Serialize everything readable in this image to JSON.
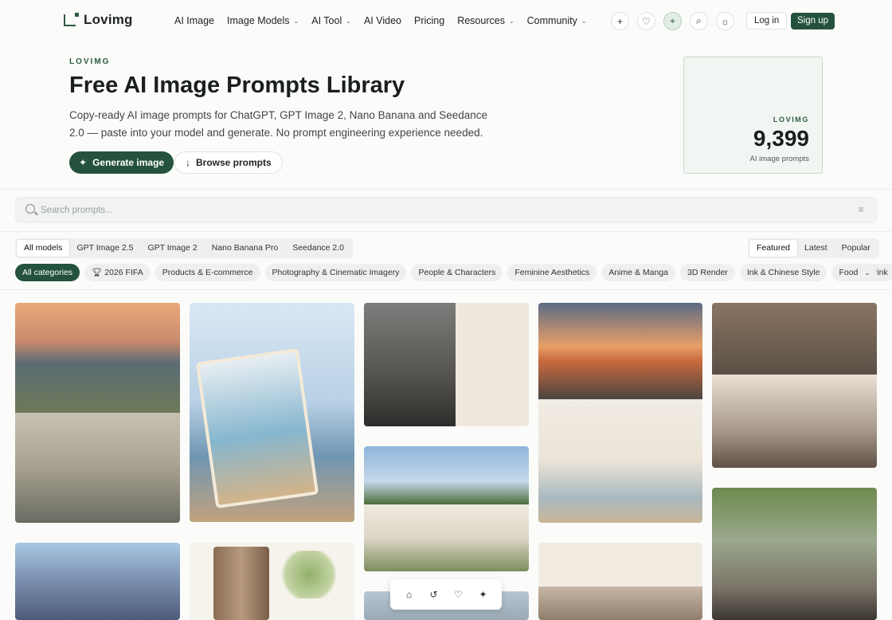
{
  "brand": {
    "name": "Lovimg"
  },
  "nav": [
    {
      "label": "AI Image",
      "chevron": false
    },
    {
      "label": "Image Models",
      "chevron": true
    },
    {
      "label": "AI Tool",
      "chevron": true
    },
    {
      "label": "AI Video",
      "chevron": false
    },
    {
      "label": "Pricing",
      "chevron": false
    },
    {
      "label": "Resources",
      "chevron": true
    },
    {
      "label": "Community",
      "chevron": true
    }
  ],
  "header_icons": [
    "plus-icon",
    "heart-icon",
    "crosshair-icon",
    "search-zoom-icon",
    "sun-icon"
  ],
  "auth": {
    "login": "Log in",
    "signup": "Sign up"
  },
  "hero": {
    "eyebrow": "LOVIMG",
    "title": "Free AI Image Prompts Library",
    "subtitle": "Copy-ready AI image prompts for ChatGPT, GPT Image 2, Nano Banana and Seedance 2.0 — paste into your model and generate. No prompt engineering experience needed.",
    "primary_button": "Generate image",
    "secondary_button": "Browse prompts"
  },
  "stat": {
    "eyebrow": "LOVIMG",
    "value": "9,399",
    "label": "AI image prompts"
  },
  "search": {
    "placeholder": "Search prompts...",
    "value": ""
  },
  "model_tabs": [
    {
      "label": "All models",
      "active": true
    },
    {
      "label": "GPT Image 2.5",
      "active": false
    },
    {
      "label": "GPT Image 2",
      "active": false
    },
    {
      "label": "Nano Banana Pro",
      "active": false
    },
    {
      "label": "Seedance 2.0",
      "active": false
    }
  ],
  "sort_tabs": [
    {
      "label": "Featured",
      "active": true
    },
    {
      "label": "Latest",
      "active": false
    },
    {
      "label": "Popular",
      "active": false
    }
  ],
  "categories": [
    {
      "label": "All categories",
      "active": true
    },
    {
      "label": "2026 FIFA",
      "icon": "trophy-icon"
    },
    {
      "label": "Products & E-commerce"
    },
    {
      "label": "Photography & Cinematic Imagery"
    },
    {
      "label": "People & Characters"
    },
    {
      "label": "Feminine Aesthetics"
    },
    {
      "label": "Anime & Manga"
    },
    {
      "label": "3D Render"
    },
    {
      "label": "Ink & Chinese Style"
    },
    {
      "label": "Food & Drink"
    }
  ],
  "colors": {
    "accent": "#24523d",
    "bg": "#fbfcfa"
  },
  "float_bar_icons": [
    "home-icon",
    "history-icon",
    "heart-icon",
    "sparkle-icon"
  ]
}
